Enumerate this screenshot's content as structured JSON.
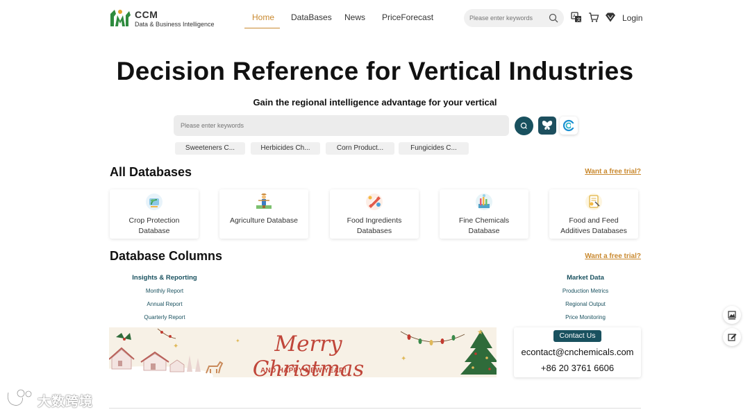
{
  "header": {
    "logo_name": "CCM",
    "logo_sub": "Data & Business Intelligence",
    "nav": [
      "Home",
      "DataBases",
      "News",
      "PriceForecast"
    ],
    "search_placeholder": "Please enter keywords",
    "login": "Login"
  },
  "hero": {
    "title": "Decision Reference for Vertical Industries",
    "subtitle": "Gain the regional intelligence advantage for your vertical",
    "search_placeholder": "Please enter keywords",
    "chips": [
      "Sweeteners C...",
      "Herbicides Ch...",
      "Corn Product...",
      "Fungicides C..."
    ]
  },
  "databases": {
    "title": "All Databases",
    "trial": "Want a free trial?",
    "cards": [
      {
        "line1": "Crop Protection",
        "line2": "Database",
        "icon": "crop-protection-icon"
      },
      {
        "line1": "Agriculture Database",
        "line2": "",
        "icon": "agriculture-icon"
      },
      {
        "line1": "Food Ingredients",
        "line2": "Databases",
        "icon": "food-ingredients-icon"
      },
      {
        "line1": "Fine Chemicals",
        "line2": "Database",
        "icon": "fine-chemicals-icon"
      },
      {
        "line1": "Food and Feed",
        "line2": "Additives Databases",
        "icon": "food-feed-icon"
      }
    ]
  },
  "columns": {
    "title": "Database Columns",
    "trial": "Want a free trial?",
    "left": {
      "heading": "Insights & Reporting",
      "items": [
        "Monthly Report",
        "Annual Report",
        "Quarterly Report"
      ]
    },
    "right": {
      "heading": "Market Data",
      "items": [
        "Production Metrics",
        "Regional Output",
        "Price Monitoring"
      ]
    }
  },
  "banner": {
    "headline": "Merry Christmas",
    "tagline": "AND HAPPY NEW YEAR!"
  },
  "contact": {
    "button": "Contact Us",
    "email": "econtact@cnchemicals.com",
    "phone": "+86 20 3761 6606"
  },
  "watermark": "大数跨境",
  "colors": {
    "accent": "#c9892f",
    "teal": "#19515f"
  }
}
